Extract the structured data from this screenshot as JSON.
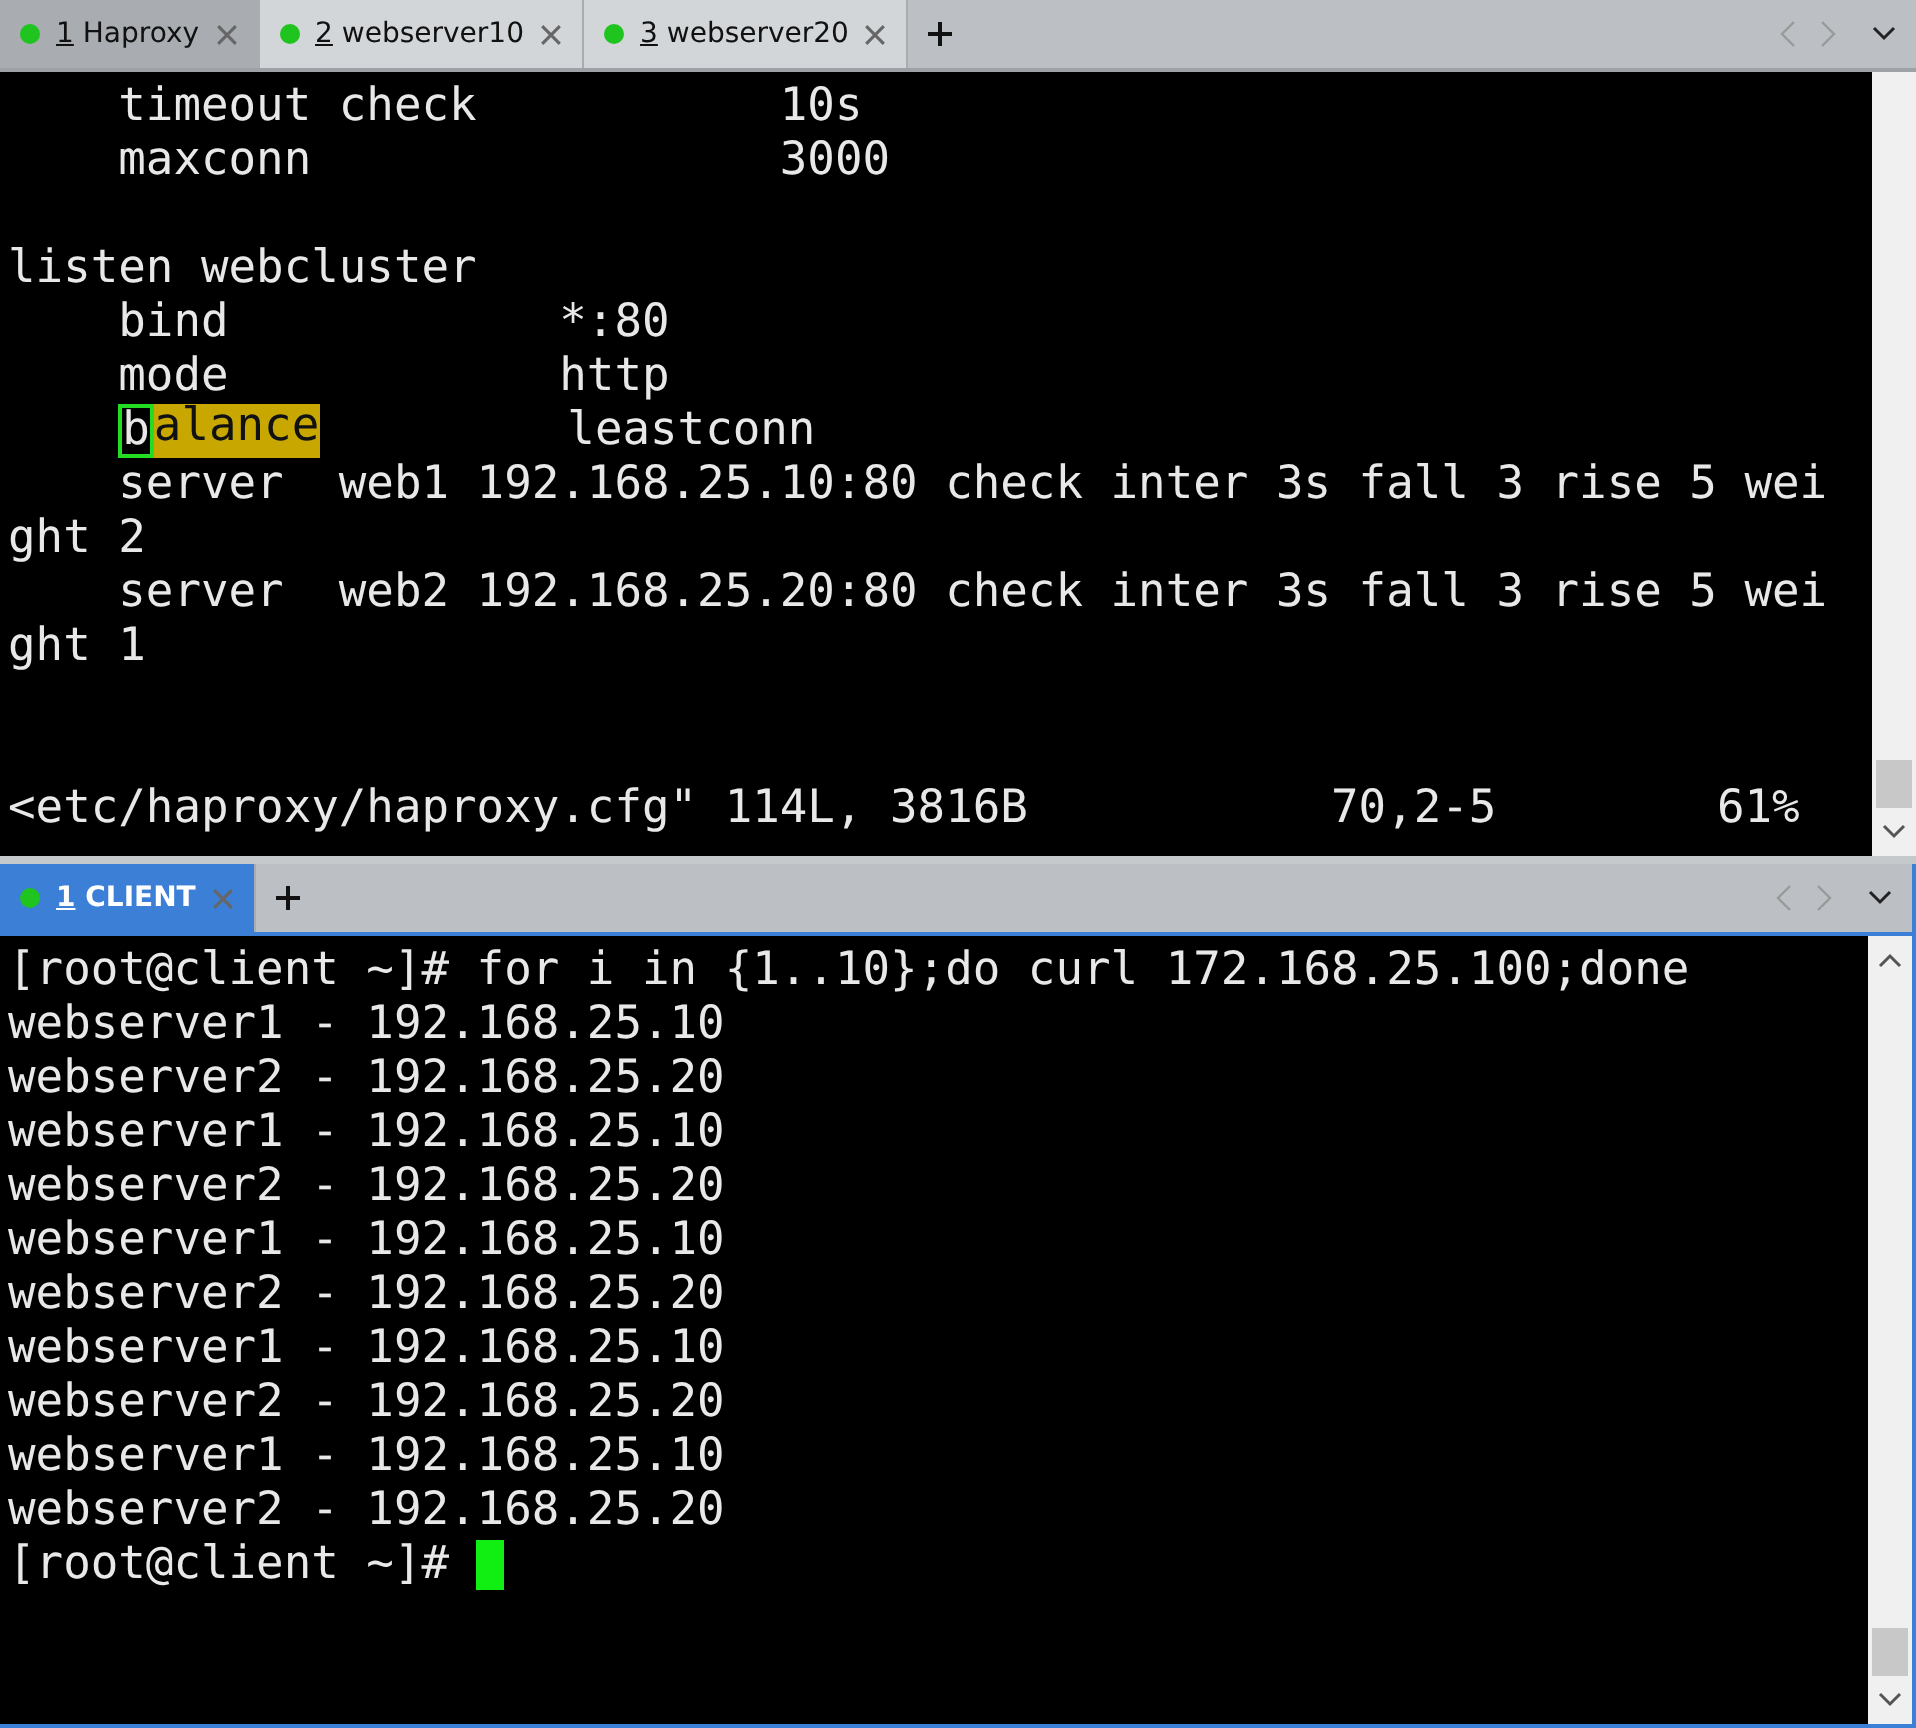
{
  "panes": [
    {
      "tabs": [
        {
          "number": "1",
          "title": "Haproxy",
          "selected": true
        },
        {
          "number": "2",
          "title": "webserver10",
          "selected": false
        },
        {
          "number": "3",
          "title": "webserver20",
          "selected": false
        }
      ],
      "focused": false,
      "lines": [
        {
          "segments": [
            {
              "kind": "plain",
              "text": "    timeout check           10s"
            }
          ]
        },
        {
          "segments": [
            {
              "kind": "plain",
              "text": "    maxconn                 3000"
            }
          ]
        },
        {
          "segments": [
            {
              "kind": "blank"
            }
          ]
        },
        {
          "segments": [
            {
              "kind": "plain",
              "text": "listen webcluster"
            }
          ]
        },
        {
          "segments": [
            {
              "kind": "plain",
              "text": "    bind            *:80"
            }
          ]
        },
        {
          "segments": [
            {
              "kind": "plain",
              "text": "    mode            http"
            }
          ]
        },
        {
          "segments": [
            {
              "kind": "indent"
            },
            {
              "kind": "cursor",
              "text": "b"
            },
            {
              "kind": "match",
              "text": "alance"
            },
            {
              "kind": "plain",
              "text": "         leastconn"
            }
          ]
        },
        {
          "segments": [
            {
              "kind": "plain",
              "text": "    server  web1 192.168.25.10:80 check inter 3s fall 3 rise 5 wei"
            }
          ]
        },
        {
          "segments": [
            {
              "kind": "plain",
              "text": "ght 2"
            }
          ]
        },
        {
          "segments": [
            {
              "kind": "plain",
              "text": "    server  web2 192.168.25.20:80 check inter 3s fall 3 rise 5 wei"
            }
          ]
        },
        {
          "segments": [
            {
              "kind": "plain",
              "text": "ght 1"
            }
          ]
        },
        {
          "segments": [
            {
              "kind": "blank"
            }
          ]
        },
        {
          "segments": [
            {
              "kind": "blank"
            }
          ]
        }
      ],
      "status": {
        "file": "<etc/haproxy/haproxy.cfg\" 114L, 3816B",
        "position": "70,2-5",
        "percent": "61%"
      }
    },
    {
      "tabs": [
        {
          "number": "1",
          "title": "CLIENT",
          "selected": true
        }
      ],
      "focused": true,
      "lines": [
        {
          "segments": [
            {
              "kind": "plain",
              "text": "[root@client ~]# for i in {1..10};do curl 172.168.25.100;done"
            }
          ]
        },
        {
          "segments": [
            {
              "kind": "plain",
              "text": "webserver1 - 192.168.25.10"
            }
          ]
        },
        {
          "segments": [
            {
              "kind": "plain",
              "text": "webserver2 - 192.168.25.20"
            }
          ]
        },
        {
          "segments": [
            {
              "kind": "plain",
              "text": "webserver1 - 192.168.25.10"
            }
          ]
        },
        {
          "segments": [
            {
              "kind": "plain",
              "text": "webserver2 - 192.168.25.20"
            }
          ]
        },
        {
          "segments": [
            {
              "kind": "plain",
              "text": "webserver1 - 192.168.25.10"
            }
          ]
        },
        {
          "segments": [
            {
              "kind": "plain",
              "text": "webserver2 - 192.168.25.20"
            }
          ]
        },
        {
          "segments": [
            {
              "kind": "plain",
              "text": "webserver1 - 192.168.25.10"
            }
          ]
        },
        {
          "segments": [
            {
              "kind": "plain",
              "text": "webserver2 - 192.168.25.20"
            }
          ]
        },
        {
          "segments": [
            {
              "kind": "plain",
              "text": "webserver1 - 192.168.25.10"
            }
          ]
        },
        {
          "segments": [
            {
              "kind": "plain",
              "text": "webserver2 - 192.168.25.20"
            }
          ]
        },
        {
          "segments": [
            {
              "kind": "plain",
              "text": "[root@client ~]# "
            },
            {
              "kind": "block"
            }
          ]
        }
      ]
    }
  ]
}
